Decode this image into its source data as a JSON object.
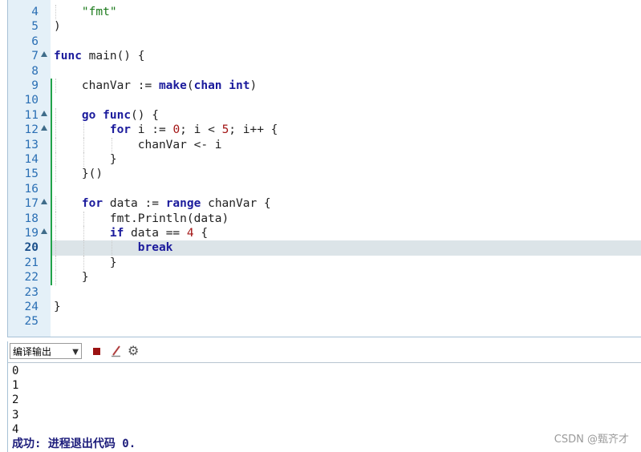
{
  "editor": {
    "current_line": 20,
    "lines": [
      {
        "n": "4",
        "fold": false
      },
      {
        "n": "5",
        "fold": false
      },
      {
        "n": "6",
        "fold": false
      },
      {
        "n": "7",
        "fold": true
      },
      {
        "n": "8",
        "fold": false
      },
      {
        "n": "9",
        "fold": false
      },
      {
        "n": "10",
        "fold": false
      },
      {
        "n": "11",
        "fold": true
      },
      {
        "n": "12",
        "fold": true
      },
      {
        "n": "13",
        "fold": false
      },
      {
        "n": "14",
        "fold": false
      },
      {
        "n": "15",
        "fold": false
      },
      {
        "n": "16",
        "fold": false
      },
      {
        "n": "17",
        "fold": true
      },
      {
        "n": "18",
        "fold": false
      },
      {
        "n": "19",
        "fold": true
      },
      {
        "n": "20",
        "fold": false
      },
      {
        "n": "21",
        "fold": false
      },
      {
        "n": "22",
        "fold": false
      },
      {
        "n": "23",
        "fold": false
      },
      {
        "n": "24",
        "fold": false
      },
      {
        "n": "25",
        "fold": false
      }
    ],
    "code": [
      [
        {
          "t": "    "
        },
        {
          "t": "\"fmt\"",
          "c": "str"
        }
      ],
      [
        {
          "t": ")"
        }
      ],
      [],
      [
        {
          "t": "func",
          "c": "kw"
        },
        {
          "t": " main() {"
        }
      ],
      [],
      [
        {
          "t": "    chanVar := "
        },
        {
          "t": "make",
          "c": "kw"
        },
        {
          "t": "("
        },
        {
          "t": "chan",
          "c": "kw"
        },
        {
          "t": " "
        },
        {
          "t": "int",
          "c": "kw"
        },
        {
          "t": ")"
        }
      ],
      [],
      [
        {
          "t": "    "
        },
        {
          "t": "go",
          "c": "kw"
        },
        {
          "t": " "
        },
        {
          "t": "func",
          "c": "kw"
        },
        {
          "t": "() {"
        }
      ],
      [
        {
          "t": "        "
        },
        {
          "t": "for",
          "c": "kw"
        },
        {
          "t": " i := "
        },
        {
          "t": "0",
          "c": "num"
        },
        {
          "t": "; i < "
        },
        {
          "t": "5",
          "c": "num"
        },
        {
          "t": "; i++ {"
        }
      ],
      [
        {
          "t": "            chanVar <- i"
        }
      ],
      [
        {
          "t": "        }"
        }
      ],
      [
        {
          "t": "    }()"
        }
      ],
      [],
      [
        {
          "t": "    "
        },
        {
          "t": "for",
          "c": "kw"
        },
        {
          "t": " data := "
        },
        {
          "t": "range",
          "c": "kw"
        },
        {
          "t": " chanVar {"
        }
      ],
      [
        {
          "t": "        fmt.Println(data)"
        }
      ],
      [
        {
          "t": "        "
        },
        {
          "t": "if",
          "c": "kw"
        },
        {
          "t": " data == "
        },
        {
          "t": "4",
          "c": "num"
        },
        {
          "t": " {"
        }
      ],
      [
        {
          "t": "            "
        },
        {
          "t": "break",
          "c": "kw"
        }
      ],
      [
        {
          "t": "        }"
        }
      ],
      [
        {
          "t": "    }"
        }
      ],
      [],
      [
        {
          "t": "}"
        }
      ],
      []
    ]
  },
  "output_panel": {
    "selector_value": "编译输出",
    "stop_icon": "stop-icon",
    "clear_icon": "clear-icon",
    "settings_icon": "gear-icon",
    "lines": [
      "0",
      "1",
      "2",
      "3",
      "4"
    ],
    "status": "成功: 进程退出代码 0."
  },
  "watermark": "CSDN @甄齐才",
  "colors": {
    "gutter_bg": "#e4f0f8",
    "line_number": "#2a6fb4",
    "keyword": "#1b1b9c",
    "string": "#1a7a1a",
    "number": "#a31515",
    "current_line_bg": "#dce4e8",
    "change_marker": "#22a34a",
    "status_text": "#1b1b7a"
  }
}
